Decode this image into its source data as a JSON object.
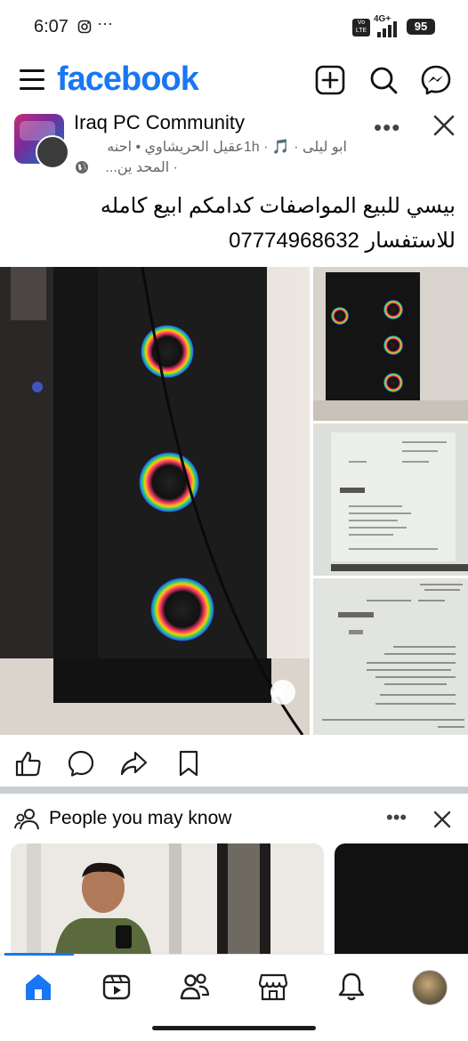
{
  "status_bar": {
    "time": "6:07",
    "more": "···",
    "network": "4G+",
    "volte": "Vo LTE",
    "battery": "95"
  },
  "header": {
    "brand": "facebook",
    "icons": [
      "menu-icon",
      "add-icon",
      "search-icon",
      "messenger-icon"
    ],
    "brand_color": "#1877f2"
  },
  "post": {
    "group_name": "Iraq PC Community",
    "meta_line1": "ابو ليلى · 🎵 · 1hعقيل الحريشاوي • احنه",
    "meta_line2": "· المحد ين...",
    "caption_line1": "بيسي للبيع المواصفات كدامكم  ابيع كامله",
    "caption_line2": "للاستفسار 07774968632",
    "more": "•••",
    "close": "✕"
  },
  "reactions": [
    "like-icon",
    "comment-icon",
    "share-icon",
    "save-icon"
  ],
  "pymk": {
    "title": "People you may know",
    "more": "•••"
  },
  "tabbar": {
    "tabs": [
      "home",
      "video",
      "friends",
      "marketplace",
      "notifications",
      "profile"
    ],
    "active": "home"
  }
}
